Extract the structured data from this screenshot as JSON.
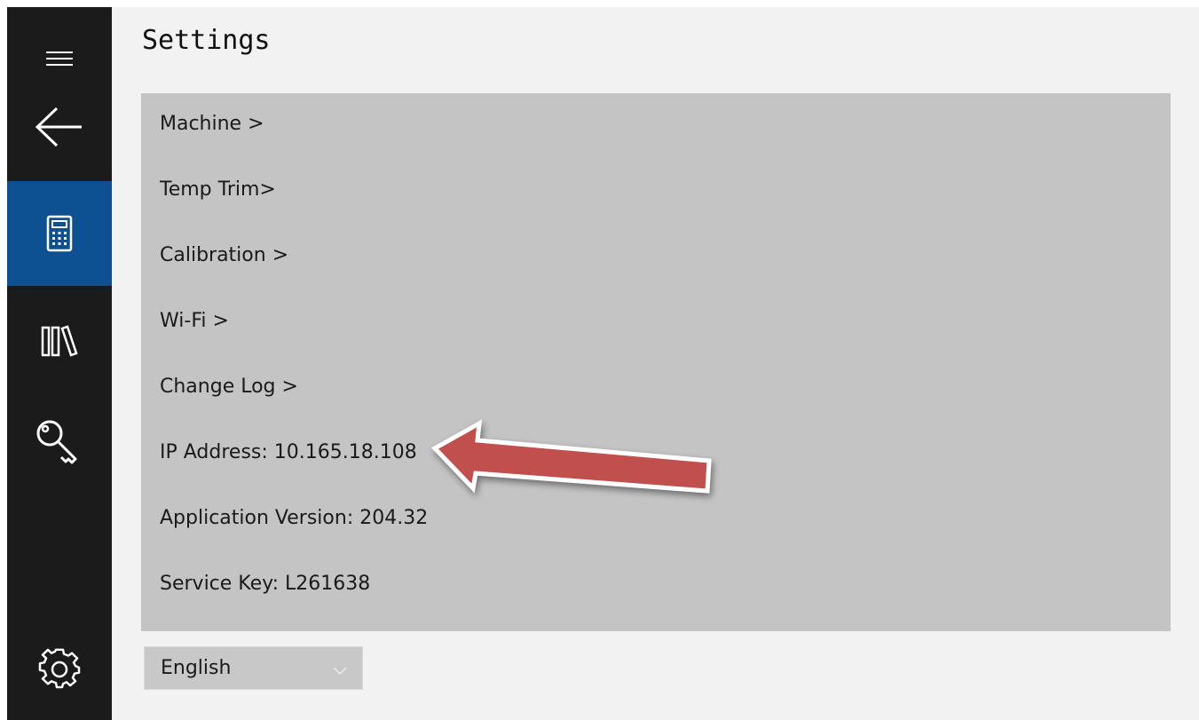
{
  "page": {
    "title": "Settings"
  },
  "sidebar": {
    "items": [
      {
        "icon": "hamburger-menu-icon"
      },
      {
        "icon": "back-arrow-icon"
      },
      {
        "icon": "calculator-icon",
        "active": true
      },
      {
        "icon": "library-icon"
      },
      {
        "icon": "key-icon"
      },
      {
        "icon": "settings-gear-icon"
      }
    ],
    "active_color": "#0e5193",
    "background_color": "#1b1b1b"
  },
  "settings": {
    "items": [
      {
        "label": "Machine >"
      },
      {
        "label": "Temp Trim>"
      },
      {
        "label": "Calibration >"
      },
      {
        "label": "Wi-Fi >"
      },
      {
        "label": "Change Log >"
      },
      {
        "label": "IP Address: 10.165.18.108"
      },
      {
        "label": "Application Version: 204.32"
      },
      {
        "label": "Service Key: L261638"
      }
    ],
    "panel_color": "#c4c4c4"
  },
  "language": {
    "selected": "English"
  },
  "annotation": {
    "type": "red-arrow",
    "points_to": "IP Address",
    "color": "#c0504d"
  }
}
